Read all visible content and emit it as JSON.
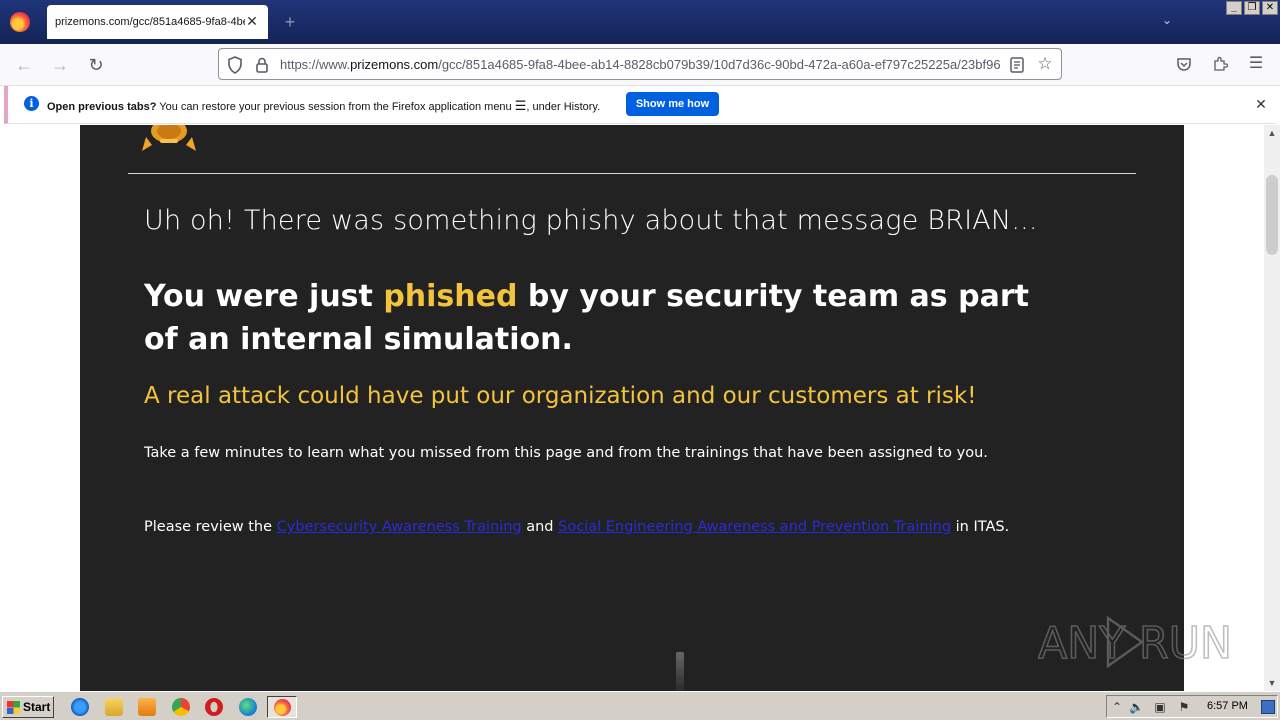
{
  "browser": {
    "tab_title": "prizemons.com/gcc/851a4685-9fa8-4bee",
    "url_domain": "prizemons.com",
    "url_prefix": "https://www.",
    "url_path": "/gcc/851a4685-9fa8-4bee-ab14-8828cb079b39/10d7d36c-90bd-472a-a60a-ef797c25225a/23bf96"
  },
  "notification": {
    "title": "Open previous tabs?",
    "message": "You can restore your previous session from the Firefox application menu",
    "message_end": ", under History.",
    "button": "Show me how"
  },
  "page": {
    "lead": "Uh oh! There was something phishy about that message BRIAN...",
    "headline_before": "You were just ",
    "headline_highlight": "phished",
    "headline_after": " by your security team as part of an internal simulation.",
    "warning": "A real attack could have put our organization and our customers at risk!",
    "para1": "Take a few minutes to learn what you missed from this page and from the trainings that have been assigned to you.",
    "para2_before": "Please review the ",
    "link1": "Cybersecurity Awareness Training",
    "para2_mid": " and ",
    "link2": "Social Engineering Awareness and Prevention Training",
    "para2_after": " in ITAS.",
    "watermark": "ANY RUN"
  },
  "taskbar": {
    "start": "Start",
    "clock": "6:57 PM"
  },
  "colors": {
    "panel_bg": "#222223",
    "highlight": "#f3c33c",
    "link": "#2b2bd6",
    "notif_button": "#0061e0"
  }
}
